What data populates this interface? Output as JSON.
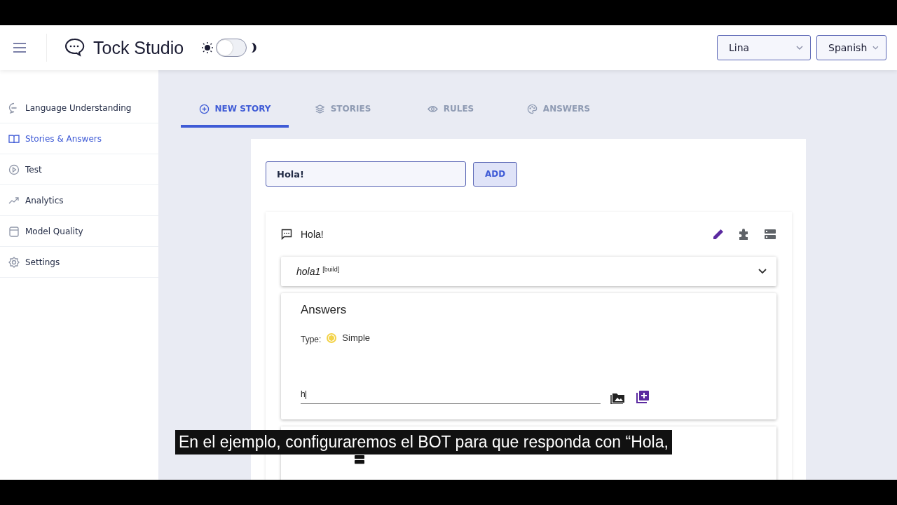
{
  "header": {
    "title": "Tock Studio",
    "dark_mode": false,
    "selects": [
      {
        "value": "Lina"
      },
      {
        "value": "Spanish"
      }
    ]
  },
  "sidebar": {
    "items": [
      {
        "label": "Language Understanding",
        "selected": false
      },
      {
        "label": "Stories & Answers",
        "selected": true
      },
      {
        "label": "Test",
        "selected": false
      },
      {
        "label": "Analytics",
        "selected": false
      },
      {
        "label": "Model Quality",
        "selected": false
      },
      {
        "label": "Settings",
        "selected": false
      }
    ]
  },
  "tabs": [
    {
      "label": "NEW STORY",
      "selected": true
    },
    {
      "label": "STORIES",
      "selected": false
    },
    {
      "label": "RULES",
      "selected": false
    },
    {
      "label": "ANSWERS",
      "selected": false
    }
  ],
  "new_story": {
    "value": "Hola!",
    "button": "ADD"
  },
  "story": {
    "title": "Hola!",
    "intent": "hola1",
    "intent_tag": "[build]",
    "expanded": false,
    "answers": {
      "heading": "Answers",
      "type_label": "Type:",
      "type_options": [
        {
          "label": "Simple",
          "selected": true
        }
      ],
      "answer_value": "h"
    }
  },
  "subtitle": "En el ejemplo, configuraremos el BOT para que responda con “Hola,"
}
